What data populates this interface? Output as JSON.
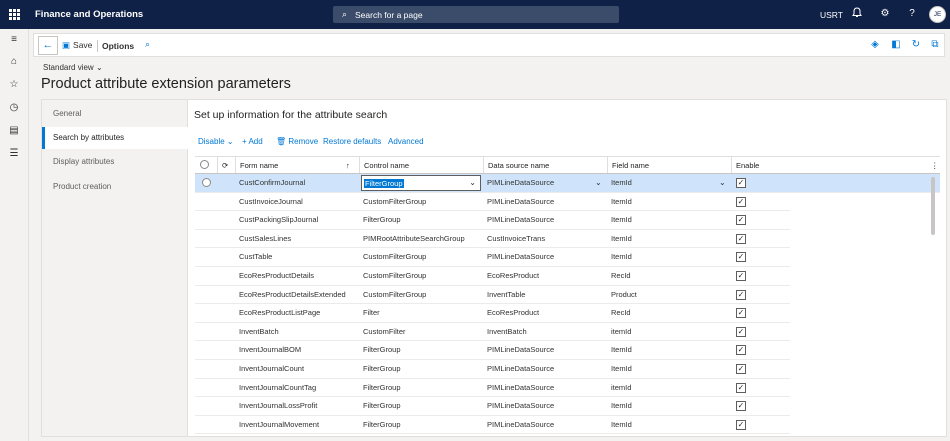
{
  "topbar": {
    "app_title": "Finance and Operations",
    "search_placeholder": "Search for a page",
    "company": "USRT",
    "avatar_initials": "JE"
  },
  "actionpane": {
    "save_label": "Save",
    "options_label": "Options"
  },
  "page": {
    "view_label": "Standard view",
    "title": "Product attribute extension parameters"
  },
  "tabs": [
    {
      "label": "General"
    },
    {
      "label": "Search by attributes"
    },
    {
      "label": "Display attributes"
    },
    {
      "label": "Product creation"
    }
  ],
  "section": {
    "title": "Set up information for the attribute search"
  },
  "toolbar": {
    "disable_label": "Disable",
    "add_label": "Add",
    "remove_label": "Remove",
    "restore_label": "Restore defaults",
    "advanced_label": "Advanced"
  },
  "grid": {
    "headers": {
      "form_name": "Form name",
      "control_name": "Control name",
      "data_source_name": "Data source name",
      "field_name": "Field name",
      "enable": "Enable"
    },
    "rows": [
      {
        "form": "CustConfirmJournal",
        "control": "FilterGroup",
        "datasource": "PIMLineDataSource",
        "field": "ItemId",
        "enabled": true
      },
      {
        "form": "CustInvoiceJournal",
        "control": "CustomFilterGroup",
        "datasource": "PIMLineDataSource",
        "field": "ItemId",
        "enabled": true
      },
      {
        "form": "CustPackingSlipJournal",
        "control": "FilterGroup",
        "datasource": "PIMLineDataSource",
        "field": "ItemId",
        "enabled": true
      },
      {
        "form": "CustSalesLines",
        "control": "PIMRootAttributeSearchGroup",
        "datasource": "CustInvoiceTrans",
        "field": "ItemId",
        "enabled": true
      },
      {
        "form": "CustTable",
        "control": "CustomFilterGroup",
        "datasource": "PIMLineDataSource",
        "field": "ItemId",
        "enabled": true
      },
      {
        "form": "EcoResProductDetails",
        "control": "CustomFilterGroup",
        "datasource": "EcoResProduct",
        "field": "RecId",
        "enabled": true
      },
      {
        "form": "EcoResProductDetailsExtended",
        "control": "CustomFilterGroup",
        "datasource": "InventTable",
        "field": "Product",
        "enabled": true
      },
      {
        "form": "EcoResProductListPage",
        "control": "Filter",
        "datasource": "EcoResProduct",
        "field": "RecId",
        "enabled": true
      },
      {
        "form": "InventBatch",
        "control": "CustomFilter",
        "datasource": "InventBatch",
        "field": "itemId",
        "enabled": true
      },
      {
        "form": "InventJournalBOM",
        "control": "FilterGroup",
        "datasource": "PIMLineDataSource",
        "field": "ItemId",
        "enabled": true
      },
      {
        "form": "InventJournalCount",
        "control": "FilterGroup",
        "datasource": "PIMLineDataSource",
        "field": "ItemId",
        "enabled": true
      },
      {
        "form": "InventJournalCountTag",
        "control": "FilterGroup",
        "datasource": "PIMLineDataSource",
        "field": "itemId",
        "enabled": true
      },
      {
        "form": "InventJournalLossProfit",
        "control": "FilterGroup",
        "datasource": "PIMLineDataSource",
        "field": "ItemId",
        "enabled": true
      },
      {
        "form": "InventJournalMovement",
        "control": "FilterGroup",
        "datasource": "PIMLineDataSource",
        "field": "ItemId",
        "enabled": true
      }
    ]
  },
  "colors": {
    "header_bg": "#0f2147",
    "accent": "#0078d4",
    "selected_row": "#cfe4fa"
  }
}
